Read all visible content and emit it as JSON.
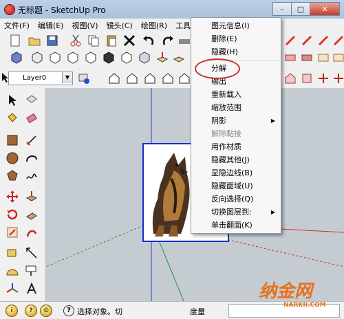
{
  "window": {
    "title": "无标题 - SketchUp Pro",
    "controls": {
      "minimize": "–",
      "maximize": "□",
      "close": "✕"
    }
  },
  "menubar": {
    "items": [
      "文件(F)",
      "编辑(E)",
      "视图(V)",
      "镜头(C)",
      "绘图(R)",
      "工具(T)"
    ]
  },
  "layer_toolbar": {
    "selected_layer": "Layer0"
  },
  "context_menu": {
    "items": [
      {
        "label": "图元信息(I)",
        "disabled": false
      },
      {
        "label": "删除(E)",
        "disabled": false
      },
      {
        "label": "隐藏(H)",
        "disabled": false
      },
      {
        "label": "分解",
        "disabled": false,
        "highlighted": true
      },
      {
        "label": "输出",
        "disabled": false
      },
      {
        "label": "重新载入",
        "disabled": false
      },
      {
        "label": "缩放范围",
        "disabled": false
      },
      {
        "label": "阴影",
        "disabled": false,
        "submenu": true
      },
      {
        "label": "解除黏接",
        "disabled": true
      },
      {
        "label": "用作材质",
        "disabled": false
      },
      {
        "label": "隐藏其他(J)",
        "disabled": false
      },
      {
        "label": "显隐边线(B)",
        "disabled": false
      },
      {
        "label": "隐藏面域(U)",
        "disabled": false
      },
      {
        "label": "反向选择(Q)",
        "disabled": false
      },
      {
        "label": "切换图层到:",
        "disabled": false,
        "submenu": true
      },
      {
        "label": "单击翻面(K)",
        "disabled": false
      }
    ],
    "submenu_glyph": "▶"
  },
  "statusbar": {
    "message": "选择对象。切",
    "measure_label": "度量",
    "help_glyph": "?",
    "geo_glyphs": [
      "i",
      "?",
      "©"
    ]
  },
  "watermark": {
    "text": "纳金网",
    "url": "NARKII.COM"
  },
  "colors": {
    "selection_blue": "#1a2bd0",
    "highlight_red": "#c9302c",
    "axis_red": "#d12a2a",
    "axis_green": "#2e8b3a",
    "axis_blue": "#2a3bd4",
    "watermark_orange": "#e8711c"
  }
}
